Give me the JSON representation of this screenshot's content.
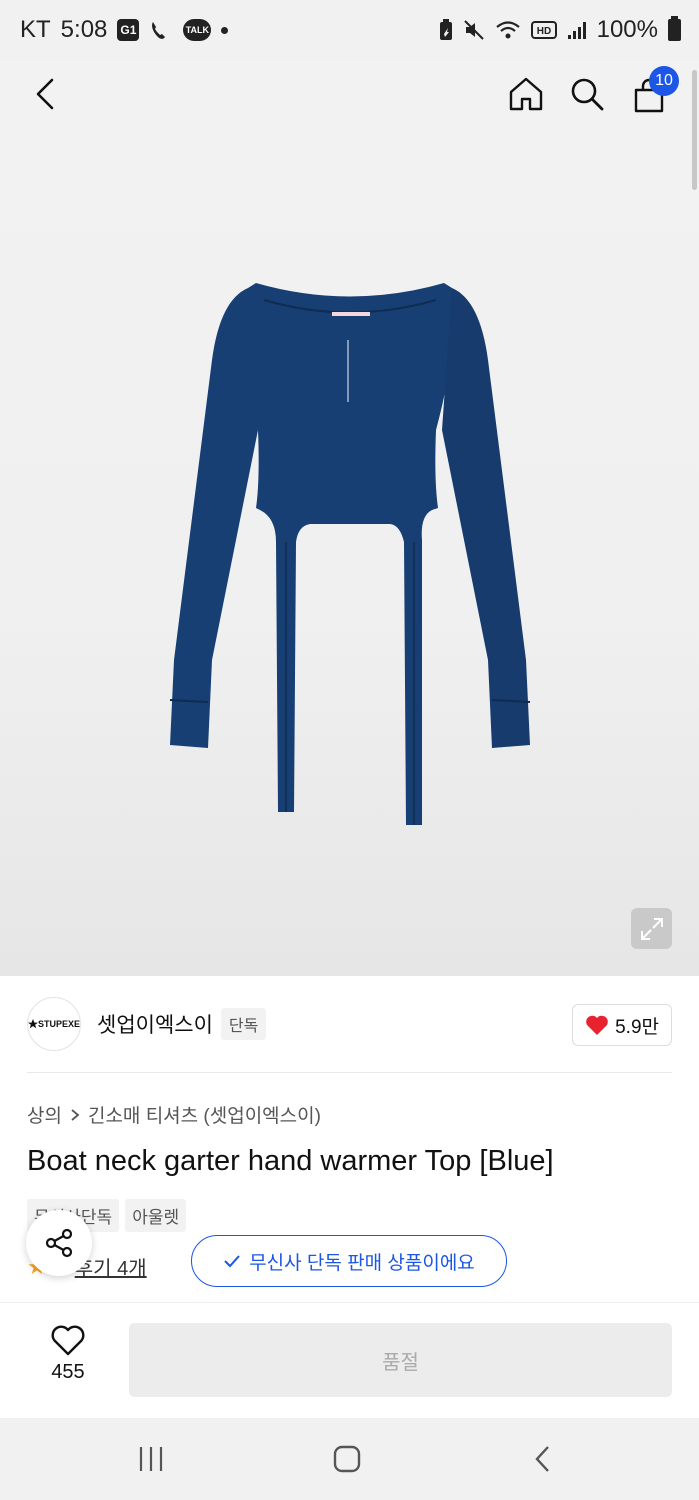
{
  "status_bar": {
    "carrier": "KT",
    "time": "5:08",
    "notif_icons": [
      "g1-icon",
      "whowho-icon",
      "kakaotalk-icon"
    ],
    "g1_text": "G1",
    "talk_text": "TALK",
    "battery": "100%"
  },
  "nav": {
    "cart_count": "10"
  },
  "brand": {
    "logo_text": "STUPEXE",
    "name": "셋업이엑스이",
    "badge": "단독",
    "likes": "5.9만"
  },
  "product": {
    "breadcrumb": [
      "상의",
      "긴소매 티셔츠 (셋업이엑스이)"
    ],
    "title": "Boat neck garter hand warmer Top [Blue]",
    "tags": [
      "무신사단독",
      "아울렛"
    ],
    "review_label": "후기 4개",
    "exclusive_label": "무신사 단독 판매 상품이에요"
  },
  "bottom": {
    "wish_count": "455",
    "soldout_label": "품절"
  },
  "colors": {
    "accent": "#1b56e6",
    "like_heart": "#e8232f",
    "product_blue": "#173f73"
  }
}
